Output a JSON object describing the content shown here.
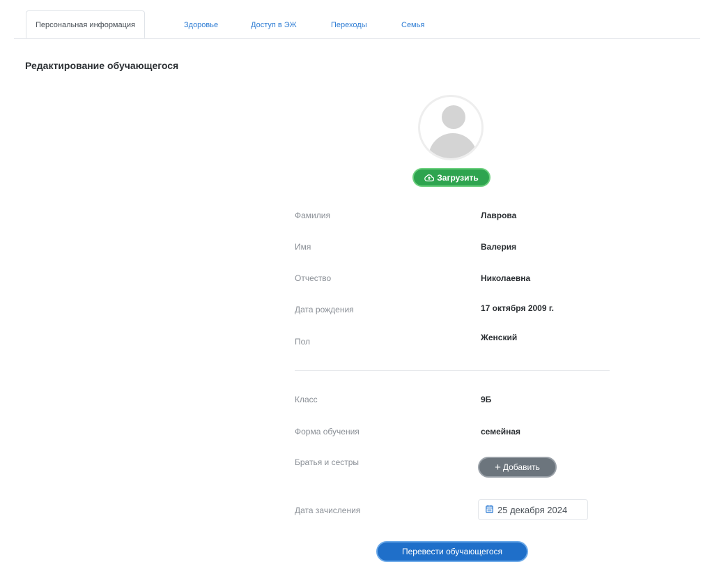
{
  "tabs": [
    {
      "label": "Персональная информация",
      "active": true
    },
    {
      "label": "Здоровье",
      "active": false
    },
    {
      "label": "Доступ в ЭЖ",
      "active": false
    },
    {
      "label": "Переходы",
      "active": false
    },
    {
      "label": "Семья",
      "active": false
    }
  ],
  "page_title": "Редактирование обучающегося",
  "avatar": {
    "icon": "user-avatar-placeholder-icon"
  },
  "upload_button": {
    "label": "Загрузить",
    "icon": "cloud-upload-icon",
    "color": "#2ea44f"
  },
  "personal_fields": [
    {
      "label": "Фамилия",
      "value": "Лаврова"
    },
    {
      "label": "Имя",
      "value": "Валерия"
    },
    {
      "label": "Отчество",
      "value": "Николаевна"
    },
    {
      "label": "Дата рождения",
      "value": "17 октября 2009 г."
    },
    {
      "label": "Пол",
      "value": "Женский"
    }
  ],
  "study_fields": {
    "class": {
      "label": "Класс",
      "value": "9Б"
    },
    "form": {
      "label": "Форма обучения",
      "value": "семейная"
    },
    "siblings": {
      "label": "Братья и сестры",
      "button_label": "Добавить",
      "button_icon": "plus-icon"
    },
    "enrollment": {
      "label": "Дата зачисления",
      "value": "25 декабря 2024",
      "icon": "calendar-icon"
    }
  },
  "transfer_button": {
    "label": "Перевести обучающегося",
    "color": "#1f6fc9"
  }
}
